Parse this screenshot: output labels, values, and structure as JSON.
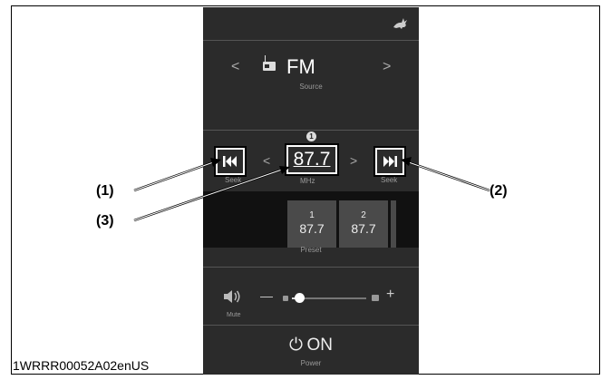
{
  "reference_code": "1WRRR00052A02enUS",
  "source": {
    "prev": "<",
    "label": "FM",
    "next": ">",
    "caption": "Source"
  },
  "tuner": {
    "marker": "1",
    "prev": "<",
    "frequency": "87.7",
    "next": ">",
    "unit": "MHz",
    "seek_back_label": "Seek",
    "seek_forward_label": "Seek"
  },
  "presets": {
    "items": [
      {
        "number": "1",
        "frequency": "87.7"
      },
      {
        "number": "2",
        "frequency": "87.7"
      }
    ],
    "caption": "Preset"
  },
  "volume": {
    "mute_label": "Mute",
    "minus": "—",
    "plus": "+",
    "level": 0.1
  },
  "power": {
    "label": "ON",
    "caption": "Power"
  },
  "callouts": {
    "seek_back": "(1)",
    "seek_forward": "(2)",
    "frequency": "(3)"
  }
}
